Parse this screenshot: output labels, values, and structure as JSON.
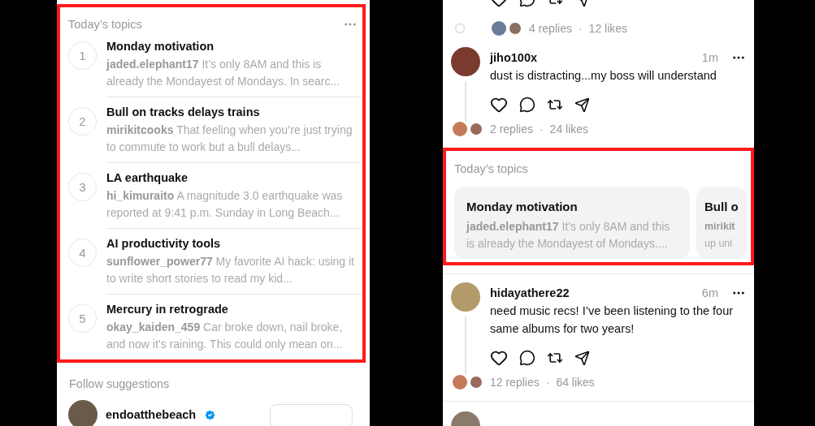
{
  "left_panel": {
    "topics": {
      "title": "Today’s topics",
      "highlighted": true,
      "items": [
        {
          "rank": "1",
          "title": "Monday motivation",
          "author": "jaded.elephant17",
          "text": "It’s only 8AM and this is already the Mondayest of Mondays. In searc..."
        },
        {
          "rank": "2",
          "title": "Bull on tracks delays trains",
          "author": "mirikitcooks",
          "text": "That feeling when you’re just trying to commute to work but a bull delays..."
        },
        {
          "rank": "3",
          "title": "LA earthquake",
          "author": "hi_kimuraito",
          "text": "A magnitude 3.0 earthquake was reported at 9:41 p.m. Sunday in Long Beach..."
        },
        {
          "rank": "4",
          "title": "AI productivity tools",
          "author": "sunflower_power77",
          "text": "My favorite AI hack: using it to write short stories to read my kid..."
        },
        {
          "rank": "5",
          "title": "Mercury in retrograde",
          "author": "okay_kaiden_459",
          "text": "Car broke down, nail broke, and now it’s raining. This could only mean on..."
        }
      ]
    },
    "follow_suggestions": {
      "title": "Follow suggestions",
      "users": [
        {
          "name": "endoatthebeach",
          "verified": true
        }
      ]
    }
  },
  "right_panel": {
    "feed": [
      {
        "kind": "stats",
        "replies": "4 replies",
        "separator": "·",
        "likes": "12 likes"
      },
      {
        "kind": "post",
        "username": "jiho100x",
        "time": "1m",
        "text": "dust is distracting...my boss will understand",
        "replies": "2 replies",
        "separator": "·",
        "likes": "24 likes"
      },
      {
        "kind": "topics",
        "title": "Today’s topics",
        "highlighted": true,
        "cards": [
          {
            "title": "Monday motivation",
            "author": "jaded.elephant17",
            "text": "It’s only 8AM and this is already the Mondayest of Mondays...."
          },
          {
            "title": "Bull o",
            "author": "mirikit",
            "text": "up unl"
          }
        ]
      },
      {
        "kind": "post",
        "username": "hidayathere22",
        "time": "6m",
        "text": "need music recs! I’ve been listening to the four same albums for two years!",
        "replies": "12 replies",
        "separator": "·",
        "likes": "64 likes"
      },
      {
        "kind": "cut"
      }
    ]
  }
}
